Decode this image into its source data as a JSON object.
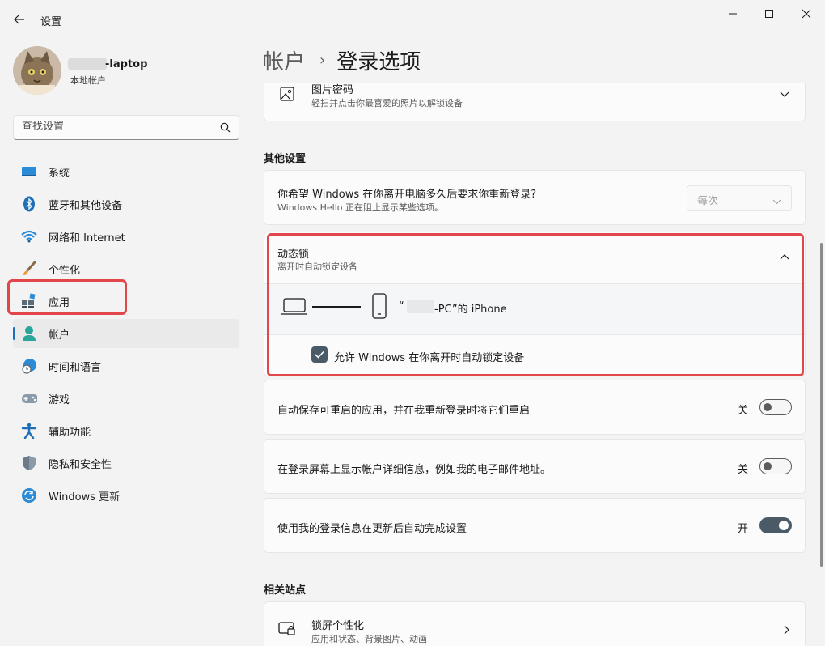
{
  "window": {
    "title": "设置",
    "back_icon": "back-arrow-icon",
    "controls": [
      "minimize-icon",
      "maximize-icon",
      "close-icon"
    ]
  },
  "account": {
    "name": "-laptop",
    "type": "本地帐户"
  },
  "search": {
    "placeholder": "查找设置"
  },
  "nav": {
    "items": [
      {
        "label": "系统",
        "icon": "system-icon"
      },
      {
        "label": "蓝牙和其他设备",
        "icon": "bluetooth-icon"
      },
      {
        "label": "网络和 Internet",
        "icon": "wifi-icon"
      },
      {
        "label": "个性化",
        "icon": "brush-icon"
      },
      {
        "label": "应用",
        "icon": "apps-icon"
      },
      {
        "label": "帐户",
        "icon": "account-icon",
        "active": true
      },
      {
        "label": "时间和语言",
        "icon": "time-language-icon"
      },
      {
        "label": "游戏",
        "icon": "gamepad-icon"
      },
      {
        "label": "辅助功能",
        "icon": "accessibility-icon"
      },
      {
        "label": "隐私和安全性",
        "icon": "shield-icon"
      },
      {
        "label": "Windows 更新",
        "icon": "update-icon"
      }
    ]
  },
  "breadcrumb": {
    "parent": "帐户",
    "separator": "›",
    "current": "登录选项"
  },
  "picture_password": {
    "title": "图片密码",
    "subtitle": "轻扫并点击你最喜爱的照片以解锁设备"
  },
  "other_settings": {
    "heading": "其他设置",
    "require_signin": {
      "title": "你希望 Windows 在你离开电脑多久后要求你重新登录?",
      "subtitle": "Windows Hello 正在阻止显示某些选项。",
      "value": "每次"
    },
    "dynamic_lock": {
      "title": "动态锁",
      "subtitle": "离开时自动锁定设备",
      "device_prefix": "“",
      "device_name": "-PC”的 iPhone",
      "checkbox_label": "允许 Windows 在你离开时自动锁定设备",
      "checked": true
    },
    "auto_save_apps": {
      "title": "自动保存可重启的应用，并在我重新登录时将它们重启",
      "state_label": "关",
      "on": false
    },
    "show_account_details": {
      "title": "在登录屏幕上显示帐户详细信息，例如我的电子邮件地址。",
      "state_label": "关",
      "on": false
    },
    "use_signin_info": {
      "title": "使用我的登录信息在更新后自动完成设置",
      "state_label": "开",
      "on": true
    }
  },
  "related": {
    "heading": "相关站点",
    "lock_screen": {
      "title": "锁屏个性化",
      "subtitle": "应用和状态、背景图片、动画"
    }
  },
  "colors": {
    "accent": "#4b5a67",
    "highlight": "#e0464a",
    "nav_indicator": "#1f6fb8"
  }
}
